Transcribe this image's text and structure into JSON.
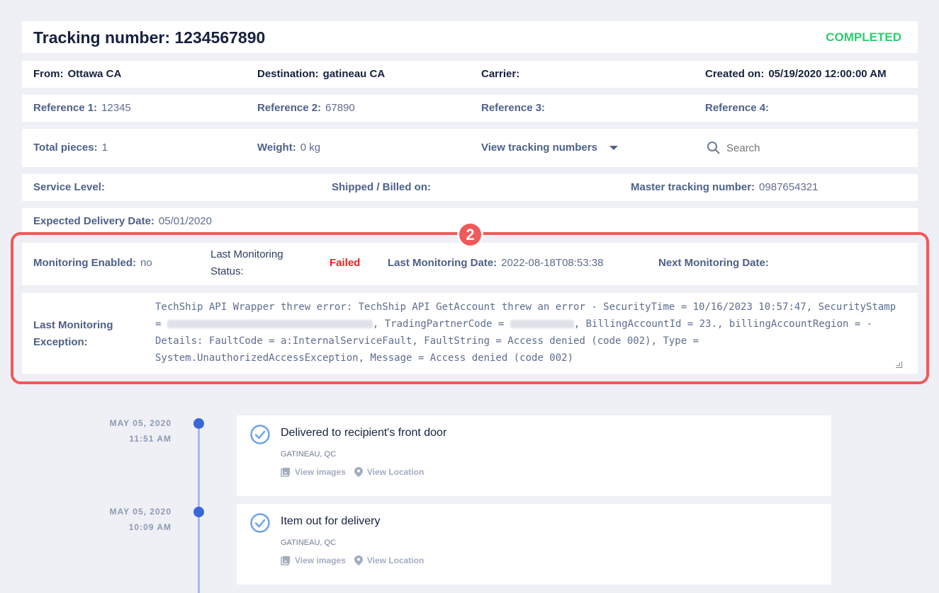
{
  "header": {
    "title": "Tracking number: 1234567890",
    "status": "COMPLETED",
    "status_color": "#2ecc71"
  },
  "row1": {
    "from_label": "From:",
    "from_value": "Ottawa CA",
    "destination_label": "Destination:",
    "destination_value": "gatineau CA",
    "carrier_label": "Carrier:",
    "carrier_value": "",
    "created_label": "Created on:",
    "created_value": "05/19/2020 12:00:00 AM"
  },
  "row2": {
    "ref1_label": "Reference 1:",
    "ref1_value": "12345",
    "ref2_label": "Reference 2:",
    "ref2_value": "67890",
    "ref3_label": "Reference 3:",
    "ref3_value": "",
    "ref4_label": "Reference 4:",
    "ref4_value": ""
  },
  "row3": {
    "pieces_label": "Total pieces:",
    "pieces_value": "1",
    "weight_label": "Weight:",
    "weight_value": "0 kg",
    "view_tracking_label": "View tracking numbers",
    "search_placeholder": "Search"
  },
  "row4": {
    "service_label": "Service Level:",
    "service_value": "",
    "shipped_label": "Shipped / Billed on:",
    "shipped_value": "",
    "master_label": "Master tracking number:",
    "master_value": "0987654321"
  },
  "row5": {
    "expected_label": "Expected Delivery Date:",
    "expected_value": "05/01/2020"
  },
  "monitoring": {
    "badge": "2",
    "enabled_label": "Monitoring Enabled:",
    "enabled_value": "no",
    "last_status_label": "Last Monitoring Status:",
    "last_status_value": "Failed",
    "last_status_color": "#e02424",
    "last_date_label": "Last Monitoring Date:",
    "last_date_value": "2022-08-18T08:53:38",
    "next_date_label": "Next Monitoring Date:",
    "next_date_value": "",
    "exception_label": "Last Monitoring Exception:",
    "exception_part1": "TechShip API Wrapper threw error: TechShip API GetAccount threw an error - SecurityTime = 10/16/2023 10:57:47, SecurityStamp =",
    "exception_part2": ", TradingPartnerCode =",
    "exception_part3": ", BillingAccountId = 23., billingAccountRegion = - Details: FaultCode = a:InternalServiceFault, FaultString = Access denied (code 002), Type = System.UnauthorizedAccessException, Message = Access denied (code 002)",
    "frame_color": "#f05a5a"
  },
  "timeline": {
    "events": [
      {
        "date": "MAY 05, 2020",
        "time": "11:51 AM",
        "title": "Delivered to recipient's front door",
        "location": "GATINEAU, QC",
        "view_images": "View images",
        "view_location": "View Location"
      },
      {
        "date": "MAY 05, 2020",
        "time": "10:09 AM",
        "title": "Item out for delivery",
        "location": "GATINEAU, QC",
        "view_images": "View images",
        "view_location": "View Location"
      }
    ]
  },
  "icons": [
    "search-icon",
    "chevron-down-icon",
    "check-circle-icon",
    "images-icon",
    "location-pin-icon"
  ]
}
